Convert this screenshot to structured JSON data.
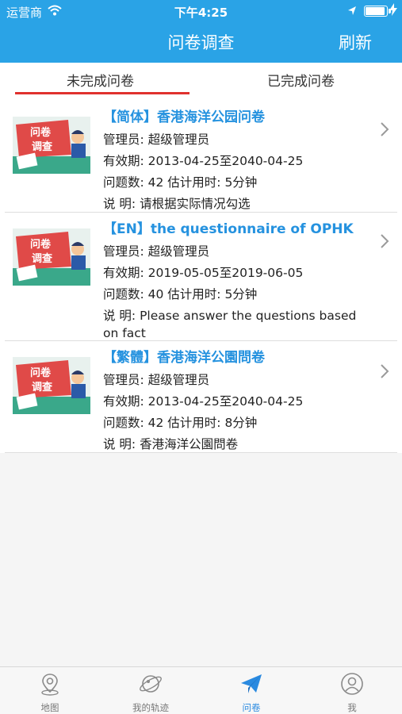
{
  "status_bar": {
    "carrier": "运营商",
    "time": "下午4:25",
    "battery_level": 0.95
  },
  "nav": {
    "title": "问卷调查",
    "refresh_label": "刷新"
  },
  "tabs": [
    {
      "label": "未完成问卷",
      "selected": true
    },
    {
      "label": "已完成问卷",
      "selected": false
    }
  ],
  "thumbnail_text": [
    "问卷",
    "调查"
  ],
  "colors": {
    "nav_blue": "#2aa3e6",
    "title_blue": "#2592df",
    "tab_underline": "#e0312d",
    "active_tab_icon": "#2a8ae0"
  },
  "surveys": [
    {
      "title": "【简体】香港海洋公园问卷",
      "admin": "管理员: 超级管理员",
      "validity": "有效期: 2013-04-25至2040-04-25",
      "questions": "问题数: 42  估计用时: 5分钟",
      "desc": "说   明: 请根据实际情况勾选"
    },
    {
      "title": "【EN】the questionnaire of OPHK",
      "admin": "管理员: 超级管理员",
      "validity": "有效期: 2019-05-05至2019-06-05",
      "questions": "问题数: 40  估计用时: 5分钟",
      "desc": "说   明: Please answer the questions based on fact"
    },
    {
      "title": "【繁體】香港海洋公園問卷",
      "admin": "管理员: 超级管理员",
      "validity": "有效期: 2013-04-25至2040-04-25",
      "questions": "问题数: 42  估计用时: 8分钟",
      "desc": "说   明: 香港海洋公園問卷"
    }
  ],
  "tabbar": [
    {
      "label": "地图",
      "icon": "map-pin-icon",
      "active": false
    },
    {
      "label": "我的轨迹",
      "icon": "planet-icon",
      "active": false
    },
    {
      "label": "问卷",
      "icon": "paper-plane-icon",
      "active": true
    },
    {
      "label": "我",
      "icon": "user-icon",
      "active": false
    }
  ]
}
